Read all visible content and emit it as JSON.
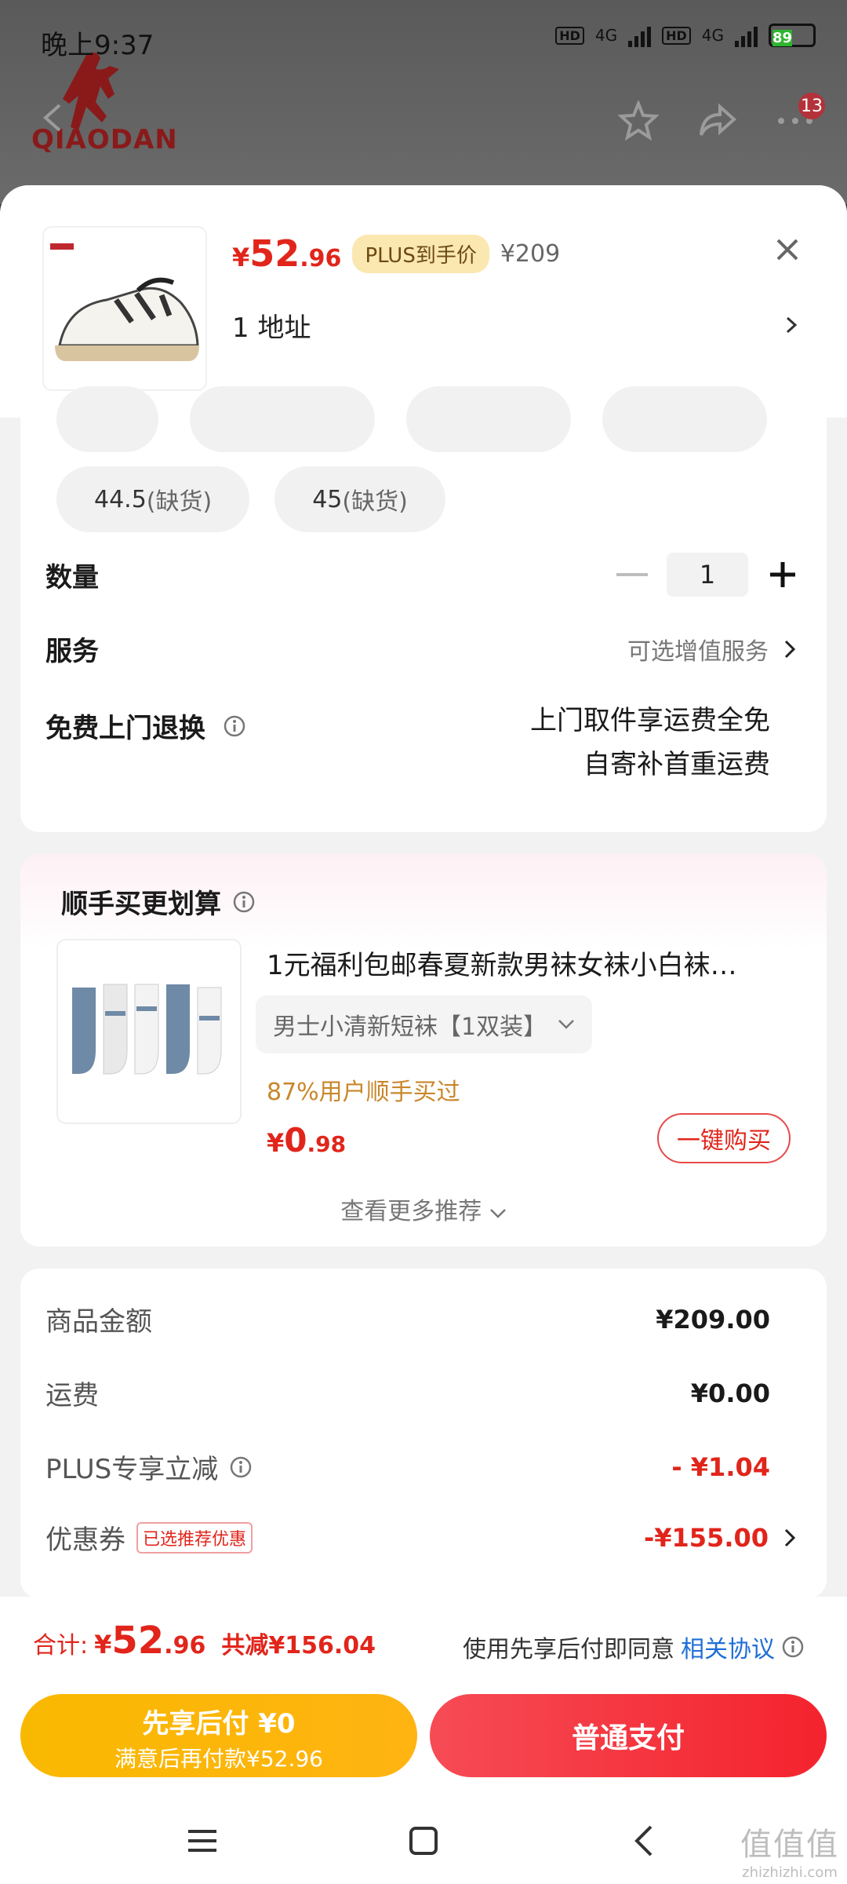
{
  "status_bar": {
    "time": "晚上9:37",
    "net1": "4G",
    "net2": "4G",
    "battery": "89"
  },
  "background": {
    "brand": "QIAODAN",
    "cart_badge": "13"
  },
  "product": {
    "price_yen": "¥",
    "price_int": "52",
    "price_dec": ".96",
    "plus_tag": "PLUS到手价",
    "original_price": "¥209",
    "address": "1  地址"
  },
  "sizes_visible": [
    {
      "size": "44.5",
      "status": "(缺货)"
    },
    {
      "size": "45",
      "status": "(缺货)"
    }
  ],
  "quantity": {
    "label": "数量",
    "value": "1"
  },
  "service": {
    "label": "服务",
    "value": "可选增值服务"
  },
  "free_return": {
    "label": "免费上门退换",
    "line1": "上门取件享运费全免",
    "line2": "自寄补首重运费"
  },
  "recommend": {
    "title": "顺手买更划算",
    "item_name": "1元福利包邮春夏新款男袜女袜小白袜…",
    "spec": "男士小清新短袜【1双装】",
    "social": "87%用户顺手买过",
    "price_yen": "¥",
    "price_int": "0",
    "price_dec": ".98",
    "buy_label": "一键购买",
    "more": "查看更多推荐"
  },
  "summary": {
    "goods_label": "商品金额",
    "goods_value": "¥209.00",
    "shipping_label": "运费",
    "shipping_value": "¥0.00",
    "plus_label": "PLUS专享立减",
    "plus_value": "- ¥1.04",
    "coupon_label": "优惠券",
    "coupon_tag": "已选推荐优惠",
    "coupon_value": "-¥155.00"
  },
  "bottom": {
    "total_label": "合计:",
    "total_yen": "¥",
    "total_int": "52",
    "total_dec": ".96",
    "total_save": "共减¥156.04",
    "agree_text": "使用先享后付即同意",
    "agree_link": "相关协议",
    "left_btn_line1": "先享后付 ¥0",
    "left_btn_line2": "满意后再付款¥52.96",
    "right_btn": "普通支付"
  },
  "watermark": {
    "line1": "值值值",
    "line2": "zhizhizhi.com"
  },
  "colors": {
    "accent_red": "#e1251b",
    "plus_gold": "#fbe7b0",
    "pay_yellow": "#f9b800",
    "link_blue": "#1f6fd6"
  }
}
